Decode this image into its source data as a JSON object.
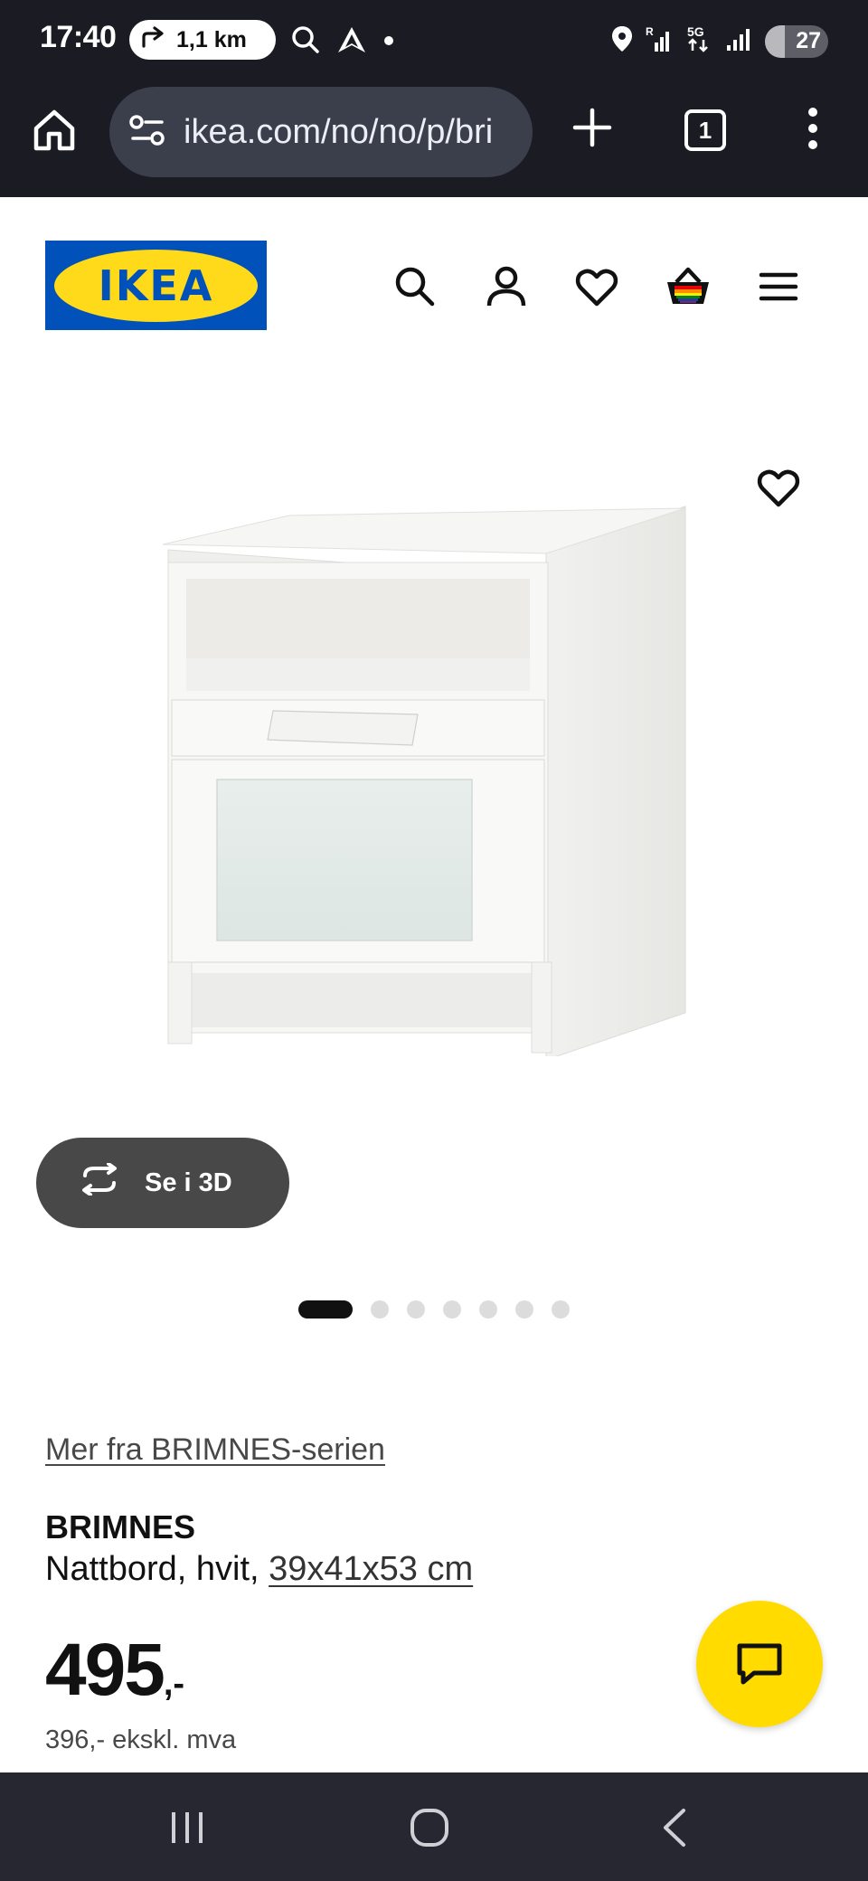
{
  "status_bar": {
    "time": "17:40",
    "navigation_distance": "1,1 km",
    "battery": "27",
    "network_label": "5G",
    "roaming_label": "R",
    "icons": [
      "directions-icon",
      "search-icon",
      "navigation-arrow-icon",
      "notification-dot-icon",
      "location-icon",
      "signal-icon",
      "battery-icon"
    ]
  },
  "browser": {
    "url": "ikea.com/no/no/p/bri",
    "tab_count": "1",
    "icons": [
      "home-icon",
      "site-settings-icon",
      "new-tab-icon",
      "tab-switcher-icon",
      "more-menu-icon"
    ]
  },
  "site_header": {
    "logo_text": "IKEA",
    "icons": [
      "search-icon",
      "account-icon",
      "favorites-icon",
      "cart-icon",
      "hamburger-menu-icon"
    ]
  },
  "gallery": {
    "view_3d_label": "Se i 3D",
    "image_count": 7,
    "active_image_index": 0
  },
  "product": {
    "series_link": "Mer fra BRIMNES-serien",
    "name": "BRIMNES",
    "description_prefix": "Nattbord, hvit, ",
    "dimensions": "39x41x53 cm",
    "price_main": "495",
    "price_suffix": ",-",
    "price_ex_vat": "396,- ekskl. mva"
  },
  "colors": {
    "ikea_blue": "#0051ba",
    "ikea_yellow": "#ffda1a",
    "chat_yellow": "#ffdb00",
    "chrome_dark": "#1a1b23"
  }
}
